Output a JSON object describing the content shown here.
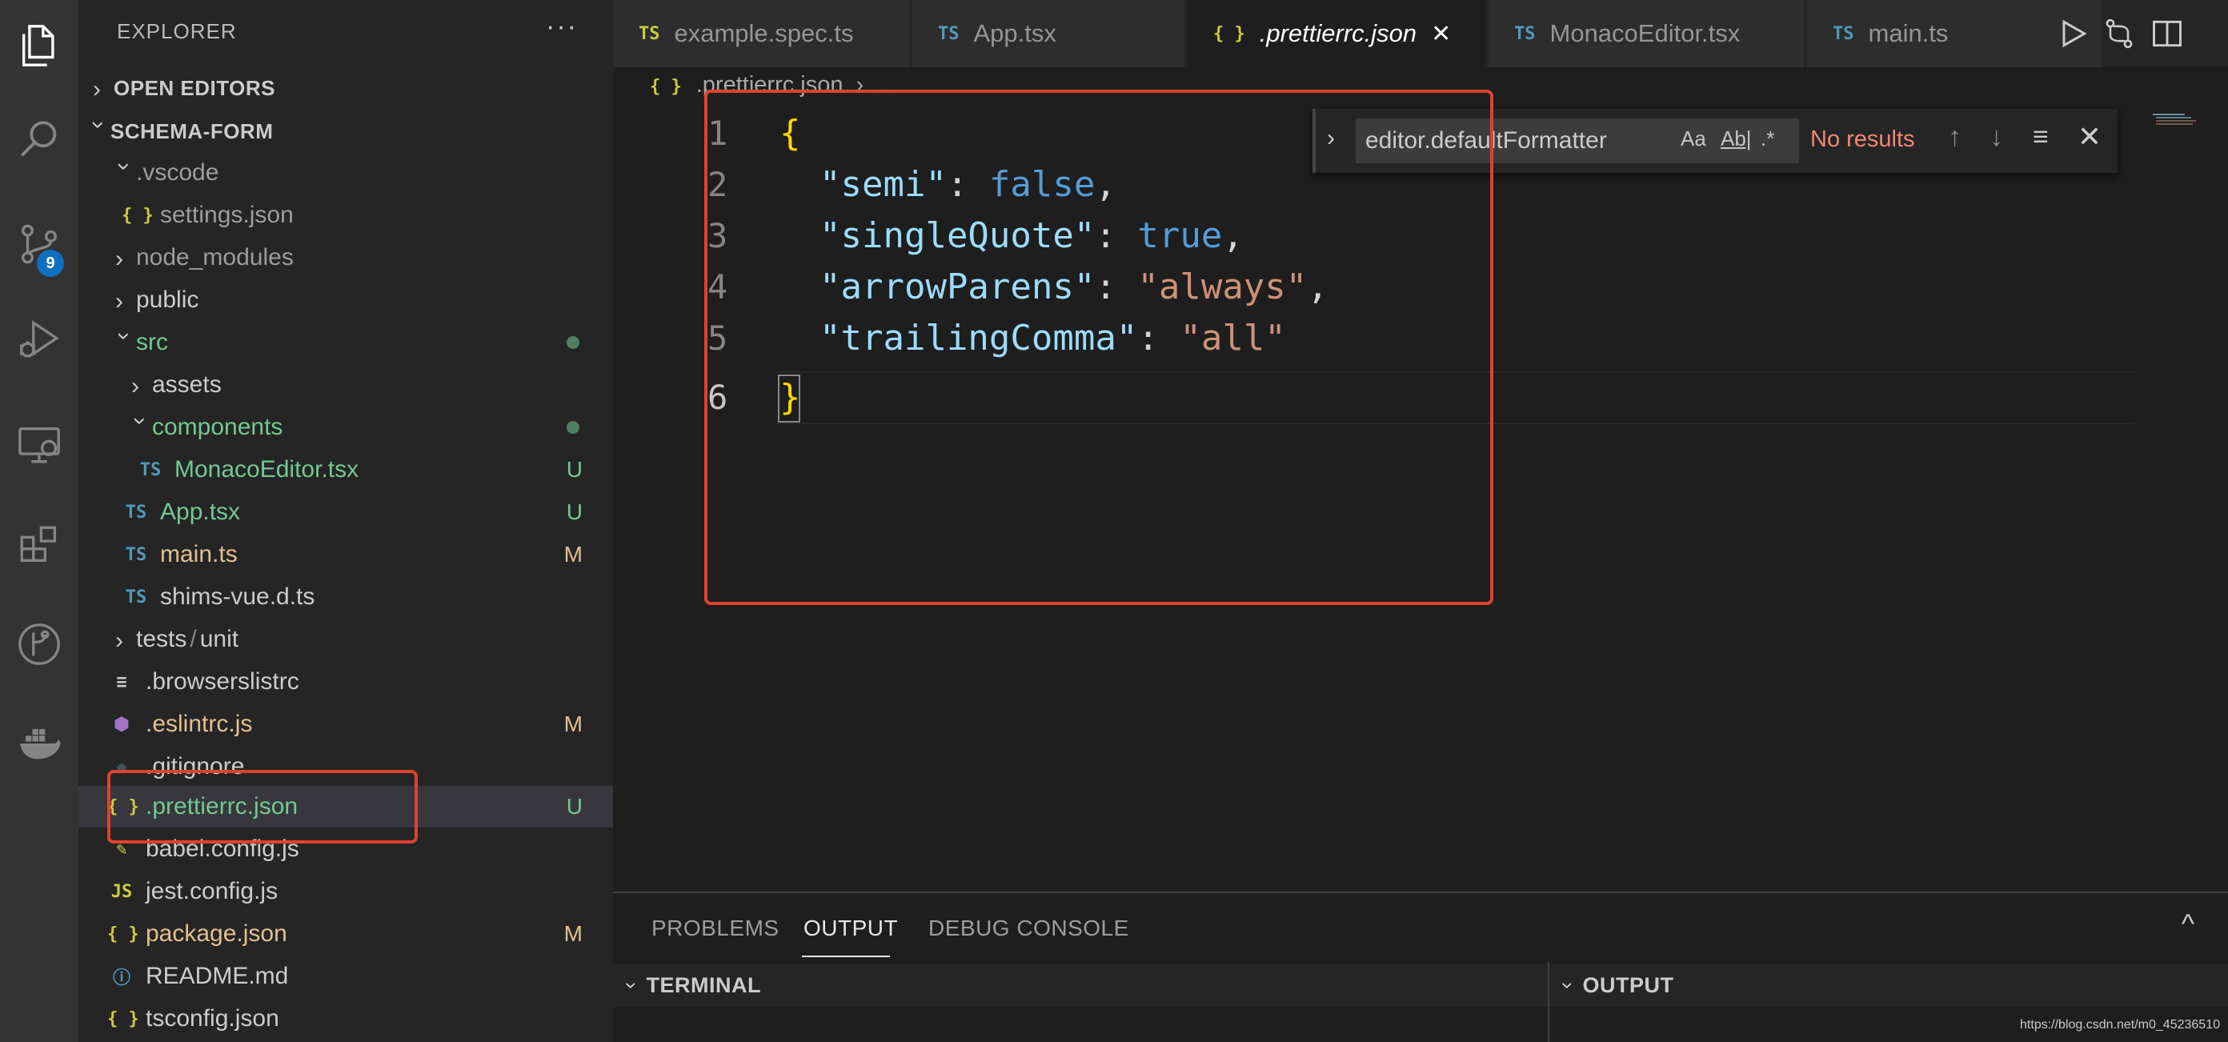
{
  "activity_bar": {
    "items": [
      "explorer",
      "search",
      "source-control",
      "run-debug",
      "remote-explorer",
      "extensions",
      "git-graph",
      "docker"
    ],
    "scm_badge": "9"
  },
  "sidebar": {
    "title": "EXPLORER",
    "more": "···",
    "sections": {
      "open_editors": "OPEN EDITORS",
      "workspace": "SCHEMA-FORM"
    },
    "tree": [
      {
        "label": ".vscode",
        "status": ""
      },
      {
        "label": "settings.json",
        "status": ""
      },
      {
        "label": "node_modules",
        "status": ""
      },
      {
        "label": "public",
        "status": ""
      },
      {
        "label": "src",
        "status": ""
      },
      {
        "label": "assets",
        "status": ""
      },
      {
        "label": "components",
        "status": ""
      },
      {
        "label": "MonacoEditor.tsx",
        "status": "U"
      },
      {
        "label": "App.tsx",
        "status": "U"
      },
      {
        "label": "main.ts",
        "status": "M"
      },
      {
        "label": "shims-vue.d.ts",
        "status": ""
      },
      {
        "label": "tests",
        "label2": "unit",
        "sep": "/",
        "status": ""
      },
      {
        "label": ".browserslistrc",
        "status": ""
      },
      {
        "label": ".eslintrc.js",
        "status": "M"
      },
      {
        "label": ".gitignore",
        "status": ""
      },
      {
        "label": ".prettierrc.json",
        "status": "U"
      },
      {
        "label": "babel.config.js",
        "status": ""
      },
      {
        "label": "jest.config.js",
        "status": ""
      },
      {
        "label": "package.json",
        "status": "M"
      },
      {
        "label": "README.md",
        "status": ""
      },
      {
        "label": "tsconfig.json",
        "status": ""
      }
    ],
    "icons": {
      "ts": "TS",
      "json": "{ }",
      "js": "JS",
      "info": "ⓘ",
      "lines": "≡"
    }
  },
  "tabs": [
    {
      "icon": "TS",
      "label": "example.spec.ts"
    },
    {
      "icon": "TS",
      "label": "App.tsx"
    },
    {
      "icon": "{ }",
      "label": ".prettierrc.json",
      "close": "✕"
    },
    {
      "icon": "TS",
      "label": "MonacoEditor.tsx"
    },
    {
      "icon": "TS",
      "label": "main.ts"
    }
  ],
  "breadcrumb": {
    "icon": "{ }",
    "file": ".prettierrc.json",
    "sep": "›",
    "rest": "..."
  },
  "editor": {
    "line_numbers": [
      "1",
      "2",
      "3",
      "4",
      "5",
      "6"
    ],
    "lines": [
      {
        "open": "{"
      },
      {
        "key": "\"semi\"",
        "colon": ": ",
        "val": "false",
        "val_type": "bool",
        "tail": ","
      },
      {
        "key": "\"singleQuote\"",
        "colon": ": ",
        "val": "true",
        "val_type": "bool",
        "tail": ","
      },
      {
        "key": "\"arrowParens\"",
        "colon": ": ",
        "val": "\"always\"",
        "val_type": "string",
        "tail": ","
      },
      {
        "key": "\"trailingComma\"",
        "colon": ": ",
        "val": "\"all\"",
        "val_type": "string",
        "tail": ""
      },
      {
        "close": "}"
      }
    ]
  },
  "find_widget": {
    "query": "editor.defaultFormatter",
    "opt_case": "Aa",
    "opt_word": "Ab|",
    "opt_regex": ".*",
    "result": "No results",
    "prev": "↑",
    "next": "↓",
    "selection": "≡",
    "close": "✕"
  },
  "panel": {
    "tabs": [
      "PROBLEMS",
      "OUTPUT",
      "DEBUG CONSOLE"
    ],
    "active_tab": "OUTPUT",
    "collapse": "^",
    "terminal_label": "TERMINAL",
    "output_label": "OUTPUT"
  },
  "watermark": "https://blog.csdn.net/m0_45236510",
  "colors": {
    "accent": "#0e70c0",
    "annotation": "#e1412f",
    "untracked": "#73c991",
    "modified": "#e2c08d"
  }
}
